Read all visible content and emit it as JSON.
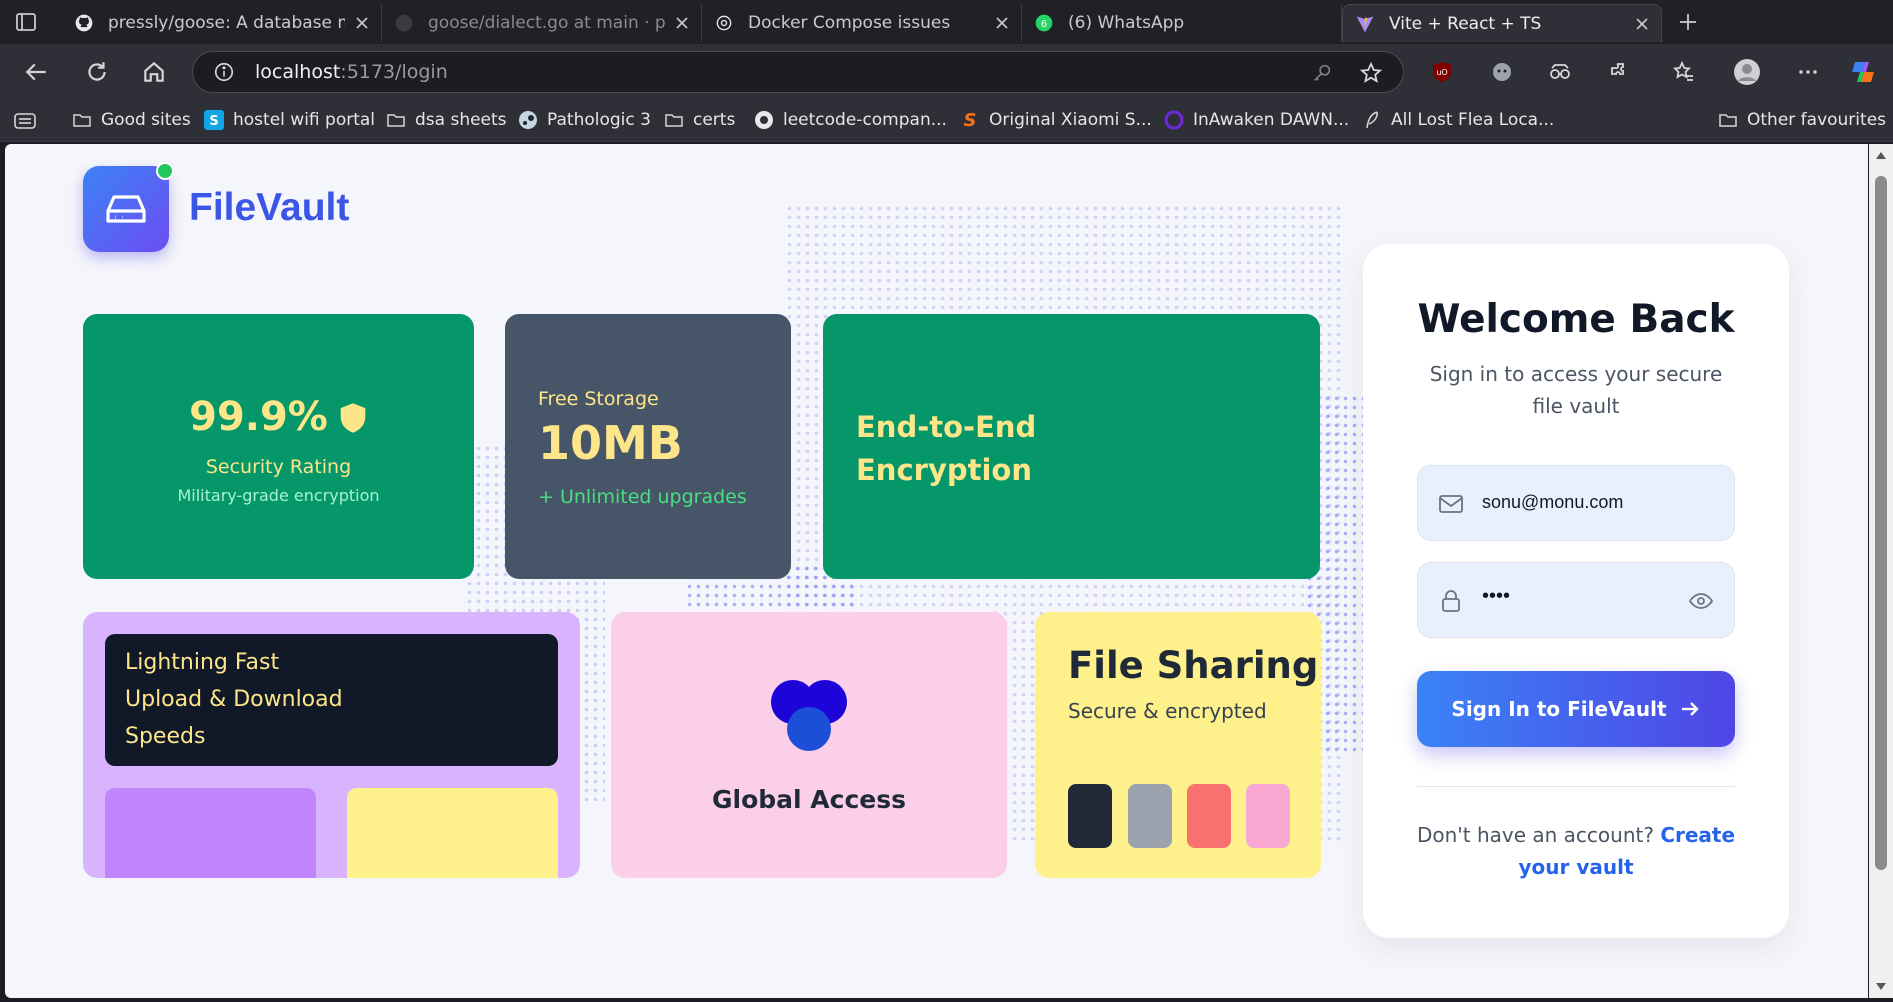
{
  "browser": {
    "tabs": [
      {
        "title": "pressly/goose: A database migr",
        "icon": "github-icon"
      },
      {
        "title": "goose/dialect.go at main · press",
        "icon": "github-icon"
      },
      {
        "title": "Docker Compose issues",
        "icon": "chatgpt-icon"
      },
      {
        "title": "(6) WhatsApp",
        "icon": "whatsapp-icon",
        "badge": "6"
      },
      {
        "title": "Vite + React + TS",
        "icon": "vite-icon",
        "active": true
      }
    ],
    "address": {
      "host": "localhost",
      "path": ":5173/login"
    },
    "bookmarks": [
      {
        "label": "Good sites",
        "icon": "folder-icon"
      },
      {
        "label": "hostel wifi portal",
        "icon": "site-s-icon"
      },
      {
        "label": "dsa sheets",
        "icon": "folder-icon"
      },
      {
        "label": "Pathologic 3",
        "icon": "steam-icon"
      },
      {
        "label": "certs",
        "icon": "folder-icon"
      },
      {
        "label": "leetcode-compan...",
        "icon": "github-icon"
      },
      {
        "label": "Original Xiaomi S...",
        "icon": "s-logo-icon"
      },
      {
        "label": "InAwaken DAWN...",
        "icon": "inawaken-icon"
      },
      {
        "label": "All Lost Flea Loca...",
        "icon": "feather-icon"
      }
    ],
    "other_favourites": "Other favourites"
  },
  "app": {
    "brand": "FileVault",
    "security": {
      "value": "99.9%",
      "label": "Security Rating",
      "sub": "Military-grade encryption"
    },
    "storage": {
      "label": "Free Storage",
      "value": "10MB",
      "sub": "+ Unlimited upgrades"
    },
    "e2e": {
      "title": "End-to-End Encryption"
    },
    "fast": {
      "lines": [
        "Lightning Fast",
        "Upload & Download",
        "Speeds"
      ]
    },
    "global": {
      "title": "Global Access"
    },
    "sharing": {
      "title": "File Sharing",
      "sub": "Secure & encrypted",
      "swatches": [
        "#1f2937",
        "#9ca3af",
        "#f87171",
        "#f9a8d4"
      ]
    }
  },
  "login": {
    "title": "Welcome Back",
    "subtitle": "Sign in to access your secure file vault",
    "email": "sonu@monu.com",
    "password": "••••",
    "button": "Sign In to FileVault",
    "no_account": "Don't have an account?",
    "create_link": "Create your vault"
  },
  "colors": {
    "accent": "#3b55e6",
    "green": "#059669",
    "slate": "#475569"
  }
}
